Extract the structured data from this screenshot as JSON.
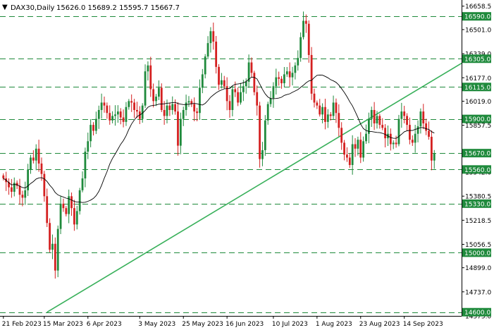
{
  "header": {
    "symbol_label": "DAX30,Daily",
    "ohlc_label": "15626.0 15689.2 15595.7 15667.7",
    "arrow_glyph": "▼"
  },
  "colors": {
    "bull": "#1f8a3c",
    "bear": "#d42020",
    "level_line": "#1f8a3c",
    "level_box": "#1f8a3c",
    "trendline": "#38b05a",
    "ma_line": "#000000",
    "axis": "#000000",
    "background": "#ffffff"
  },
  "chart_data": {
    "type": "candlestick",
    "title": "",
    "y_axis": {
      "range": [
        14575,
        16700
      ],
      "tick_labels": [
        "16658.5",
        "16501.0",
        "16339.0",
        "16177.0",
        "16019.0",
        "15857.5",
        "15542.0",
        "15380.5",
        "15218.5",
        "15056.5",
        "14899.0",
        "14737.0",
        "14575.0"
      ],
      "tick_values": [
        16658.5,
        16501.0,
        16339.0,
        16177.0,
        16019.0,
        15857.5,
        15542.0,
        15380.5,
        15218.5,
        15056.5,
        14899.0,
        14737.0,
        14575.0
      ]
    },
    "x_axis": {
      "tick_labels": [
        "21 Feb 2023",
        "15 Mar 2023",
        "6 Apr 2023",
        "3 May 2023",
        "25 May 2023",
        "16 Jun 2023",
        "10 Jul 2023",
        "1 Aug 2023",
        "23 Aug 2023",
        "14 Sep 2023"
      ],
      "tick_bar_index": [
        0,
        15,
        31,
        50,
        66,
        82,
        99,
        115,
        131,
        147
      ]
    },
    "horizontal_levels": [
      {
        "value": 16590,
        "label": "16590.0"
      },
      {
        "value": 16305,
        "label": "16305.0"
      },
      {
        "value": 16115,
        "label": "16115.0"
      },
      {
        "value": 15900,
        "label": "15900.0"
      },
      {
        "value": 15670,
        "label": "15670.0"
      },
      {
        "value": 15560,
        "label": "15560.0"
      },
      {
        "value": 15330,
        "label": "15330.0"
      },
      {
        "value": 15000,
        "label": "15000.0"
      },
      {
        "value": 14600,
        "label": "14600.0"
      }
    ],
    "trendline": {
      "from": {
        "bar": 16,
        "price": 14600
      },
      "to": {
        "bar": 183,
        "price": 16440
      }
    },
    "ma_period": 20,
    "closes": [
      15500,
      15475,
      15440,
      15410,
      15470,
      15450,
      15390,
      15370,
      15420,
      15560,
      15640,
      15620,
      15700,
      15600,
      15530,
      15380,
      15200,
      15020,
      15060,
      14880,
      15160,
      15330,
      15300,
      15260,
      15380,
      15300,
      15190,
      15280,
      15420,
      15500,
      15680,
      15750,
      15860,
      15820,
      15900,
      15960,
      16010,
      15990,
      15940,
      15890,
      15920,
      15930,
      15950,
      15910,
      15880,
      15980,
      16020,
      16010,
      15960,
      15950,
      15900,
      15990,
      16220,
      16260,
      16100,
      16020,
      16050,
      16110,
      15960,
      15920,
      15990,
      15960,
      16000,
      15950,
      15720,
      15900,
      15960,
      16010,
      16020,
      16000,
      15950,
      15940,
      16110,
      16200,
      16320,
      16410,
      16490,
      16420,
      16250,
      16130,
      16160,
      16120,
      16020,
      15960,
      16100,
      16080,
      16010,
      16080,
      16120,
      16150,
      16280,
      16210,
      16080,
      15990,
      15630,
      15690,
      15890,
      16000,
      16040,
      16120,
      16180,
      16170,
      16140,
      16200,
      16220,
      16180,
      16210,
      16260,
      16310,
      16450,
      16560,
      16540,
      16330,
      16070,
      16010,
      15990,
      15930,
      15980,
      15880,
      15930,
      15920,
      16010,
      15940,
      15840,
      15740,
      15660,
      15640,
      15590,
      15730,
      15700,
      15760,
      15640,
      15750,
      15800,
      15900,
      15960,
      15870,
      15920,
      15860,
      15840,
      15770,
      15800,
      15730,
      15740,
      15730,
      15900,
      15950,
      15920,
      15860,
      15760,
      15740,
      15800,
      15850,
      15950,
      15870,
      15820,
      15780,
      15620,
      15668
    ]
  }
}
